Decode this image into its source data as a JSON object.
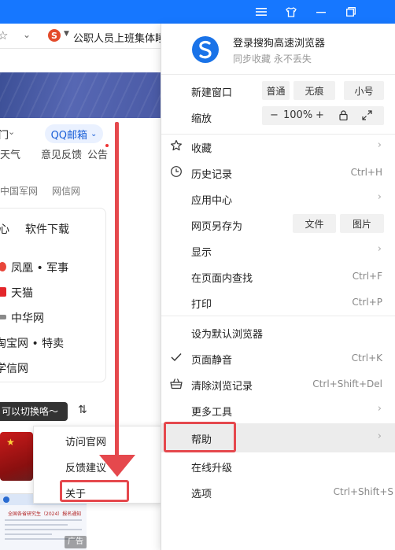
{
  "titlebar": {
    "icons": [
      "menu-icon",
      "shirt-skin-icon",
      "minimize-icon",
      "restore-icon"
    ],
    "accent": "#1677ff"
  },
  "toolbar": {
    "bookmark_text": "公职人员上班集体睡"
  },
  "page": {
    "nav_row1": [
      "门",
      "QQ邮箱"
    ],
    "nav_row2": [
      "天气",
      "意见反馈",
      "公告"
    ],
    "nav_row3": [
      "中国军网",
      "网信网"
    ],
    "card_tabs": [
      "心",
      "软件下载"
    ],
    "card_items": [
      "凤凰 • 军事",
      "天猫",
      "中华网",
      "淘宝网 • 特卖",
      "学信网"
    ],
    "tooltip": "可以切换咯～",
    "thumb_title": "全国各省研究生（2024）报名通知",
    "ad_label": "广告"
  },
  "submenu": {
    "items": [
      "访问官网",
      "反馈建议",
      "关于"
    ]
  },
  "menu": {
    "account_title": "登录搜狗高速浏览器",
    "account_sub": "同步收藏 永不丢失",
    "new_window": {
      "label": "新建窗口",
      "buttons": [
        "普通",
        "无痕",
        "小号"
      ]
    },
    "zoom": {
      "label": "缩放",
      "minus": "−",
      "value": "100%",
      "plus": "+"
    },
    "favorites": "收藏",
    "history": {
      "label": "历史记录",
      "shortcut": "Ctrl+H"
    },
    "app_center": "应用中心",
    "save_page": {
      "label": "网页另存为",
      "buttons": [
        "文件",
        "图片"
      ]
    },
    "display": "显示",
    "find": {
      "label": "在页面内查找",
      "shortcut": "Ctrl+F"
    },
    "print": {
      "label": "打印",
      "shortcut": "Ctrl+P"
    },
    "set_default": "设为默认浏览器",
    "mute": {
      "label": "页面静音",
      "shortcut": "Ctrl+K"
    },
    "clear": {
      "label": "清除浏览记录",
      "shortcut": "Ctrl+Shift+Del"
    },
    "more_tools": "更多工具",
    "help": "帮助",
    "upgrade": "在线升级",
    "options": {
      "label": "选项",
      "shortcut": "Ctrl+Shift+S"
    }
  },
  "colors": {
    "annotation": "#e5484d",
    "brand_blue": "#1a73e8"
  }
}
